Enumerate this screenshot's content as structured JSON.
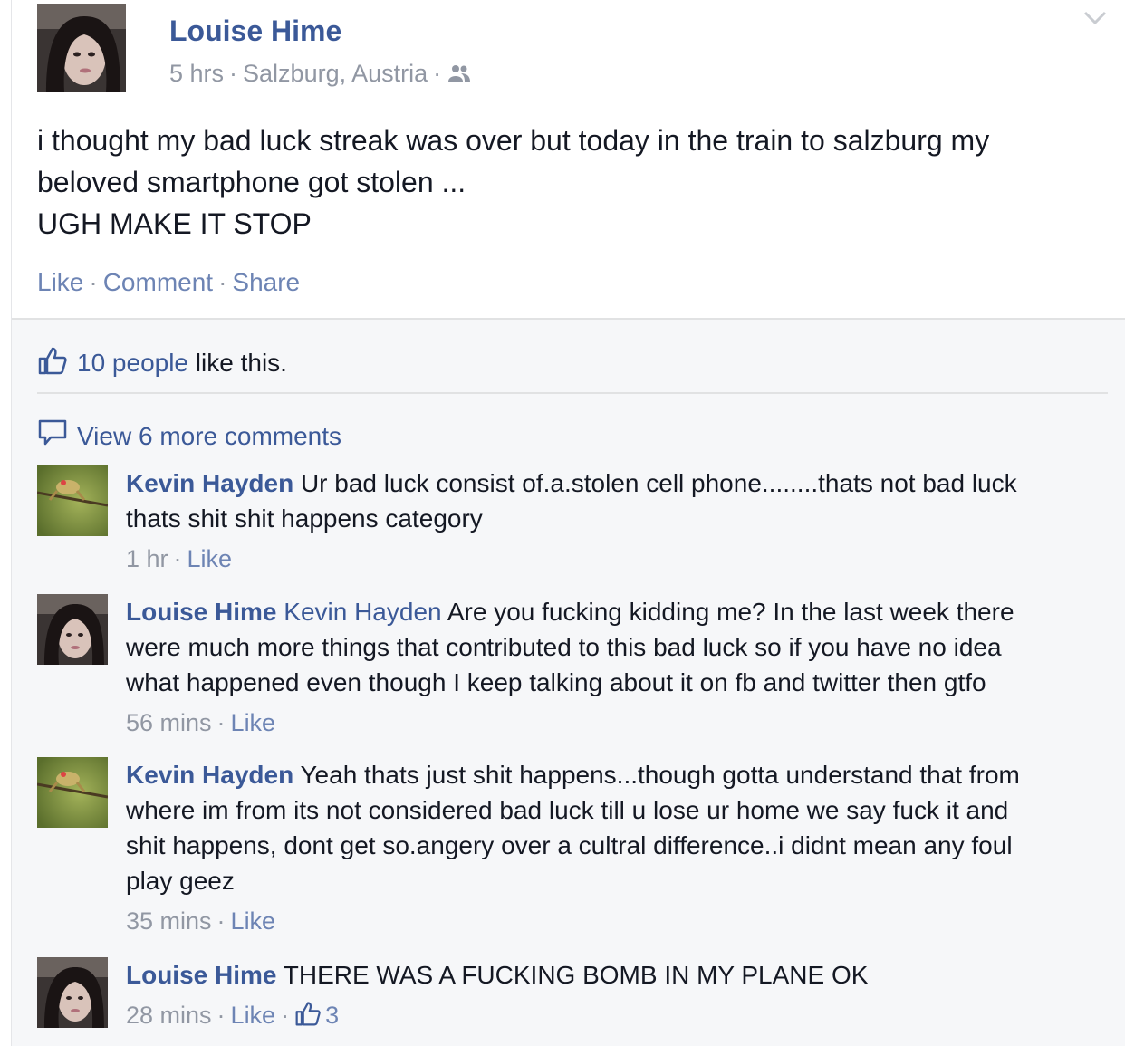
{
  "post": {
    "author": "Louise Hime",
    "time": "5 hrs",
    "location": "Salzburg, Austria",
    "audience_icon": "friends-icon",
    "text_lines": [
      "i thought my bad luck streak was over but today in the train to salzburg my",
      "beloved smartphone got stolen ...",
      "UGH MAKE IT STOP"
    ],
    "actions": {
      "like": "Like",
      "comment": "Comment",
      "share": "Share"
    }
  },
  "ufi": {
    "likes_people": "10 people",
    "likes_suffix": " like this.",
    "view_more": "View 6 more comments"
  },
  "comments": [
    {
      "author": "Kevin Hayden",
      "mention": "",
      "lines": [
        " Ur bad luck consist of.a.stolen cell phone........thats not bad luck",
        "thats shit shit happens category"
      ],
      "time": "1 hr",
      "like": "Like",
      "like_count": ""
    },
    {
      "author": "Louise Hime",
      "mention": "Kevin Hayden",
      "lines": [
        " Are you fucking kidding me? In the last week there",
        "were much more things that contributed to this bad luck so if you have no idea",
        "what happened even though I keep talking about it on fb and twitter then gtfo"
      ],
      "time": "56 mins",
      "like": "Like",
      "like_count": ""
    },
    {
      "author": "Kevin Hayden",
      "mention": "",
      "lines": [
        " Yeah thats just shit happens...though gotta understand that from",
        "where im from its not considered bad luck till u lose ur home we say fuck it and",
        "shit happens, dont get so.angery over a cultral difference..i didnt mean any foul",
        "play geez"
      ],
      "time": "35 mins",
      "like": "Like",
      "like_count": ""
    },
    {
      "author": "Louise Hime",
      "mention": "",
      "lines": [
        " THERE WAS A FUCKING BOMB IN MY PLANE OK"
      ],
      "time": "28 mins",
      "like": "Like",
      "like_count": "3"
    }
  ],
  "colors": {
    "link": "#3b5998",
    "muted": "#9197a3",
    "ufi_bg": "#f6f7f9"
  }
}
